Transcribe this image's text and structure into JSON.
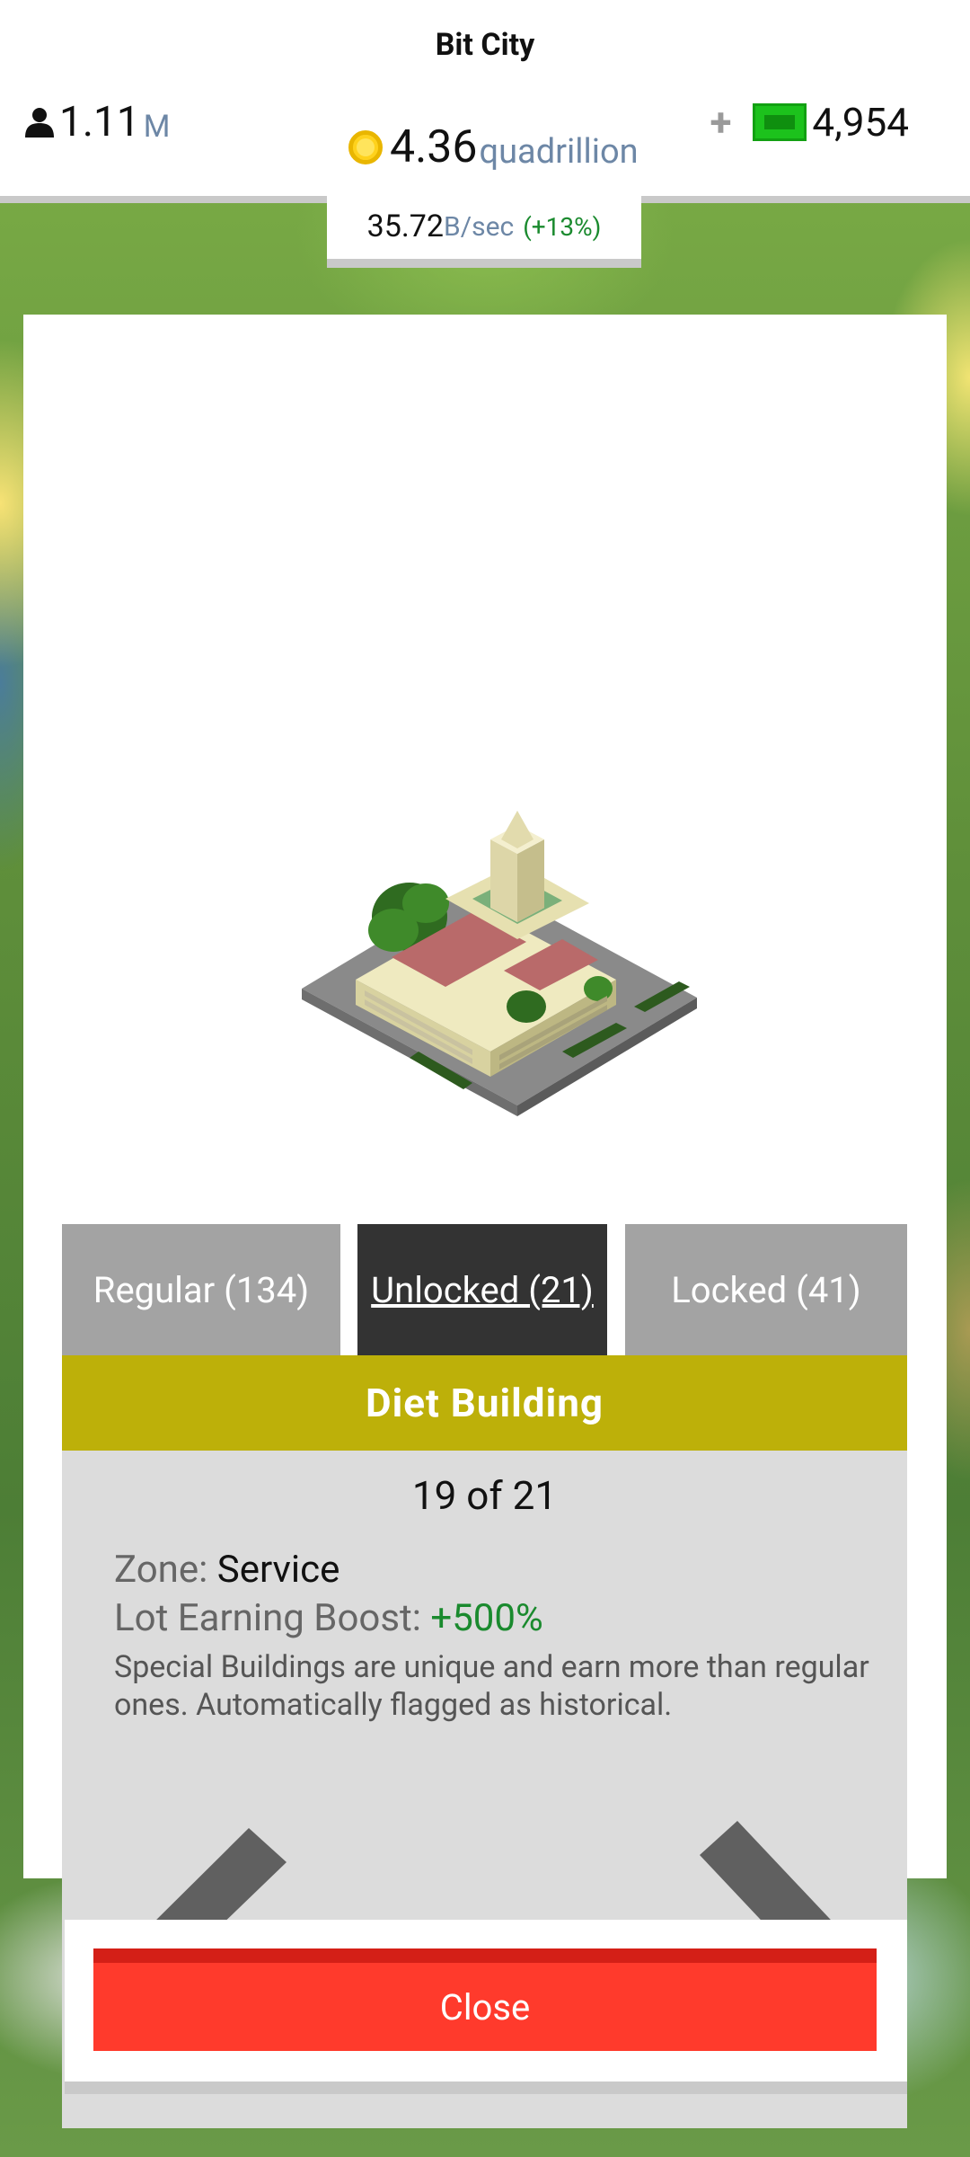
{
  "app": {
    "title": "Bit City"
  },
  "header": {
    "population_value": "1.11",
    "population_unit": "M",
    "coins_value": "4.36",
    "coins_unit": "quadrillion",
    "cash_plus": "+",
    "cash_value": "4,954",
    "rate_value": "35.72",
    "rate_unit": "B/sec",
    "rate_change": "(+13%)"
  },
  "tabs": [
    {
      "label": "Regular (134)",
      "selected": false
    },
    {
      "label": "Unlocked (21)",
      "selected": true
    },
    {
      "label": "Locked (41)",
      "selected": false
    }
  ],
  "building": {
    "name": "Diet Building",
    "counter": "19 of 21",
    "zone_label": "Zone:",
    "zone_value": "Service",
    "boost_label": "Lot Earning Boost:",
    "boost_value": "+500%",
    "description": "Special Buildings are unique and earn more than regular ones. Automatically flagged as historical."
  },
  "buttons": {
    "close_label": "Close"
  },
  "colors": {
    "title_bar": "#bdb009",
    "selected_tab": "#333333",
    "tab": "#a3a3a3",
    "close_button": "#ff3a2c",
    "boost": "#1a8a2e",
    "unit_text": "#6d87a6"
  },
  "icons": [
    "person-icon",
    "coin-icon",
    "plus-icon",
    "cash-icon",
    "chevron-left-icon",
    "chevron-right-icon"
  ]
}
